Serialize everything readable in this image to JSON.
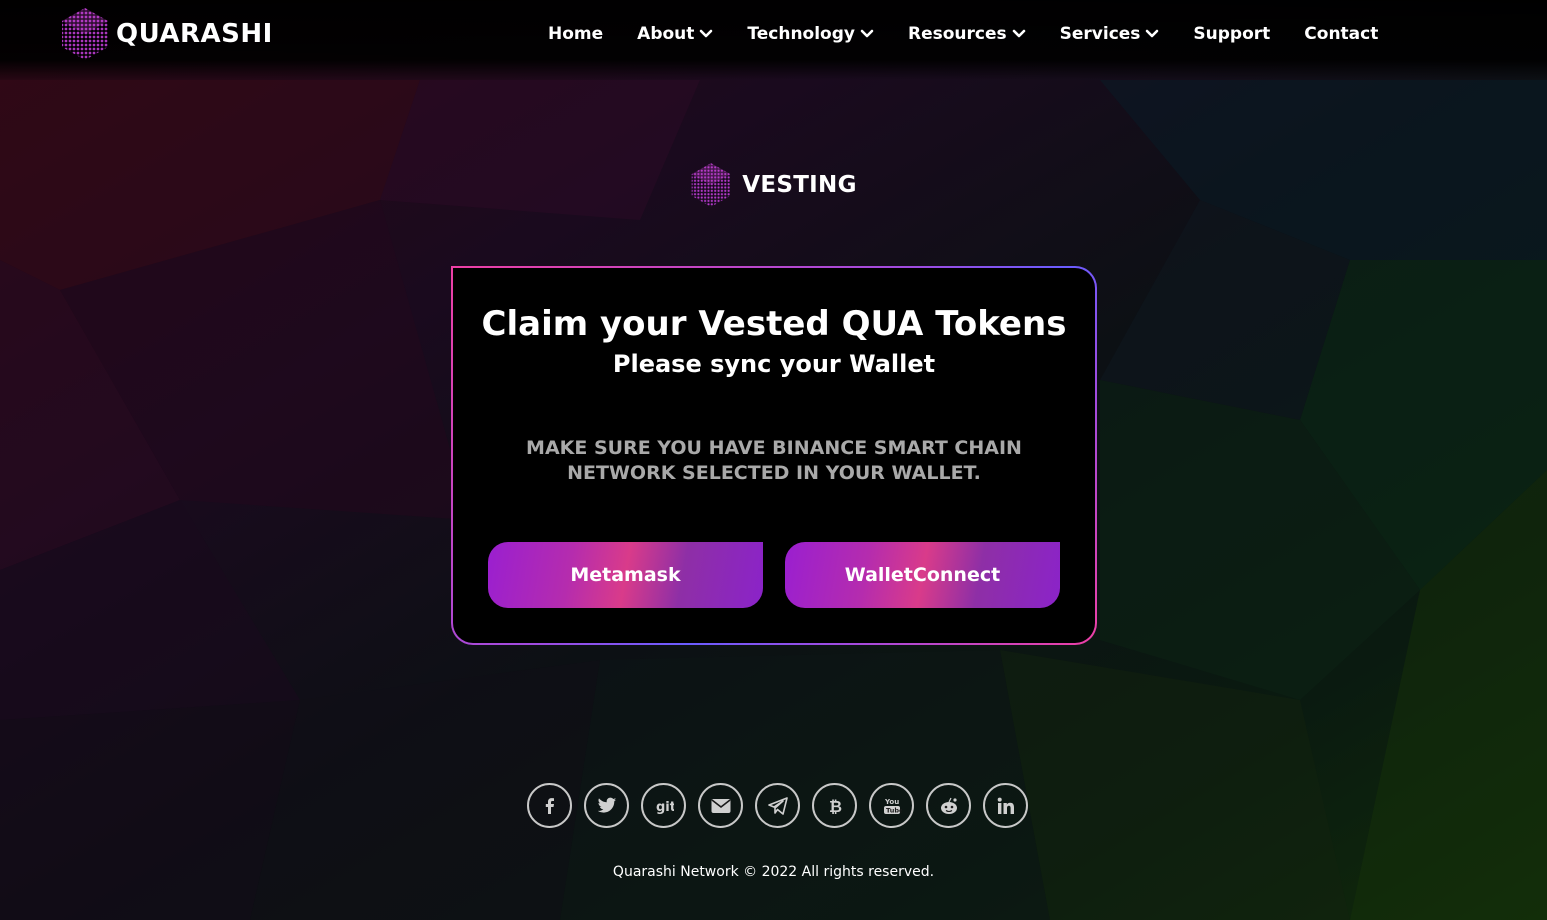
{
  "header": {
    "brand": "QUARASHI",
    "nav": [
      {
        "label": "Home",
        "dropdown": false
      },
      {
        "label": "About",
        "dropdown": true
      },
      {
        "label": "Technology",
        "dropdown": true
      },
      {
        "label": "Resources",
        "dropdown": true
      },
      {
        "label": "Services",
        "dropdown": true
      },
      {
        "label": "Support",
        "dropdown": false
      },
      {
        "label": "Contact",
        "dropdown": false
      }
    ]
  },
  "section": {
    "title": "VESTING"
  },
  "card": {
    "title": "Claim your Vested QUA Tokens",
    "subtitle": "Please sync your Wallet",
    "note": "MAKE SURE YOU HAVE BINANCE SMART CHAIN NETWORK SELECTED IN YOUR WALLET.",
    "buttons": {
      "metamask": "Metamask",
      "walletconnect": "WalletConnect"
    }
  },
  "socials": [
    {
      "icon": "facebook-icon"
    },
    {
      "icon": "twitter-icon"
    },
    {
      "icon": "git-icon"
    },
    {
      "icon": "email-icon"
    },
    {
      "icon": "telegram-icon"
    },
    {
      "icon": "bitcoin-icon"
    },
    {
      "icon": "youtube-icon"
    },
    {
      "icon": "reddit-icon"
    },
    {
      "icon": "linkedin-icon"
    }
  ],
  "footer": {
    "copyright": "Quarashi Network © 2022 All rights reserved."
  },
  "colors": {
    "accent_pink": "#ee3fa5",
    "accent_purple": "#9a1fd0",
    "accent_violet": "#6a5cff",
    "note_gray": "#a9a9a9"
  }
}
